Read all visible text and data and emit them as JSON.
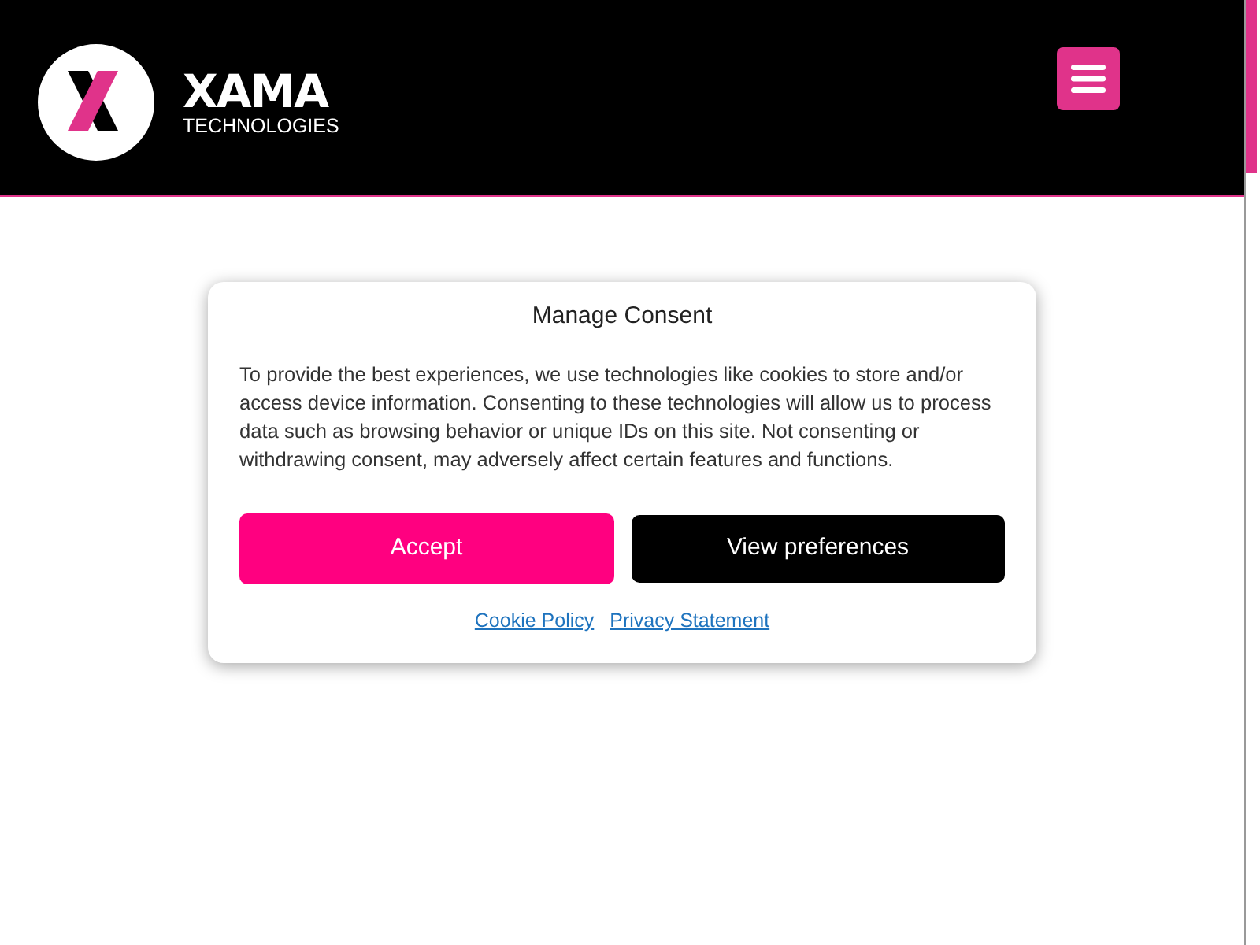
{
  "header": {
    "logo": {
      "wordmark": "XAMA",
      "tagline": "TECHNOLOGIES"
    }
  },
  "consent_dialog": {
    "title": "Manage Consent",
    "message": "To provide the best experiences, we use technologies like cookies to store and/or access device information. Consenting to these technologies will allow us to process data such as browsing behavior or unique IDs on this site. Not consenting or withdrawing consent, may adversely affect certain features and functions.",
    "buttons": [
      {
        "label": "Accept",
        "kind": "primary"
      },
      {
        "label": "View preferences",
        "kind": "secondary"
      }
    ],
    "links": [
      "Cookie Policy",
      "Privacy Statement"
    ]
  }
}
